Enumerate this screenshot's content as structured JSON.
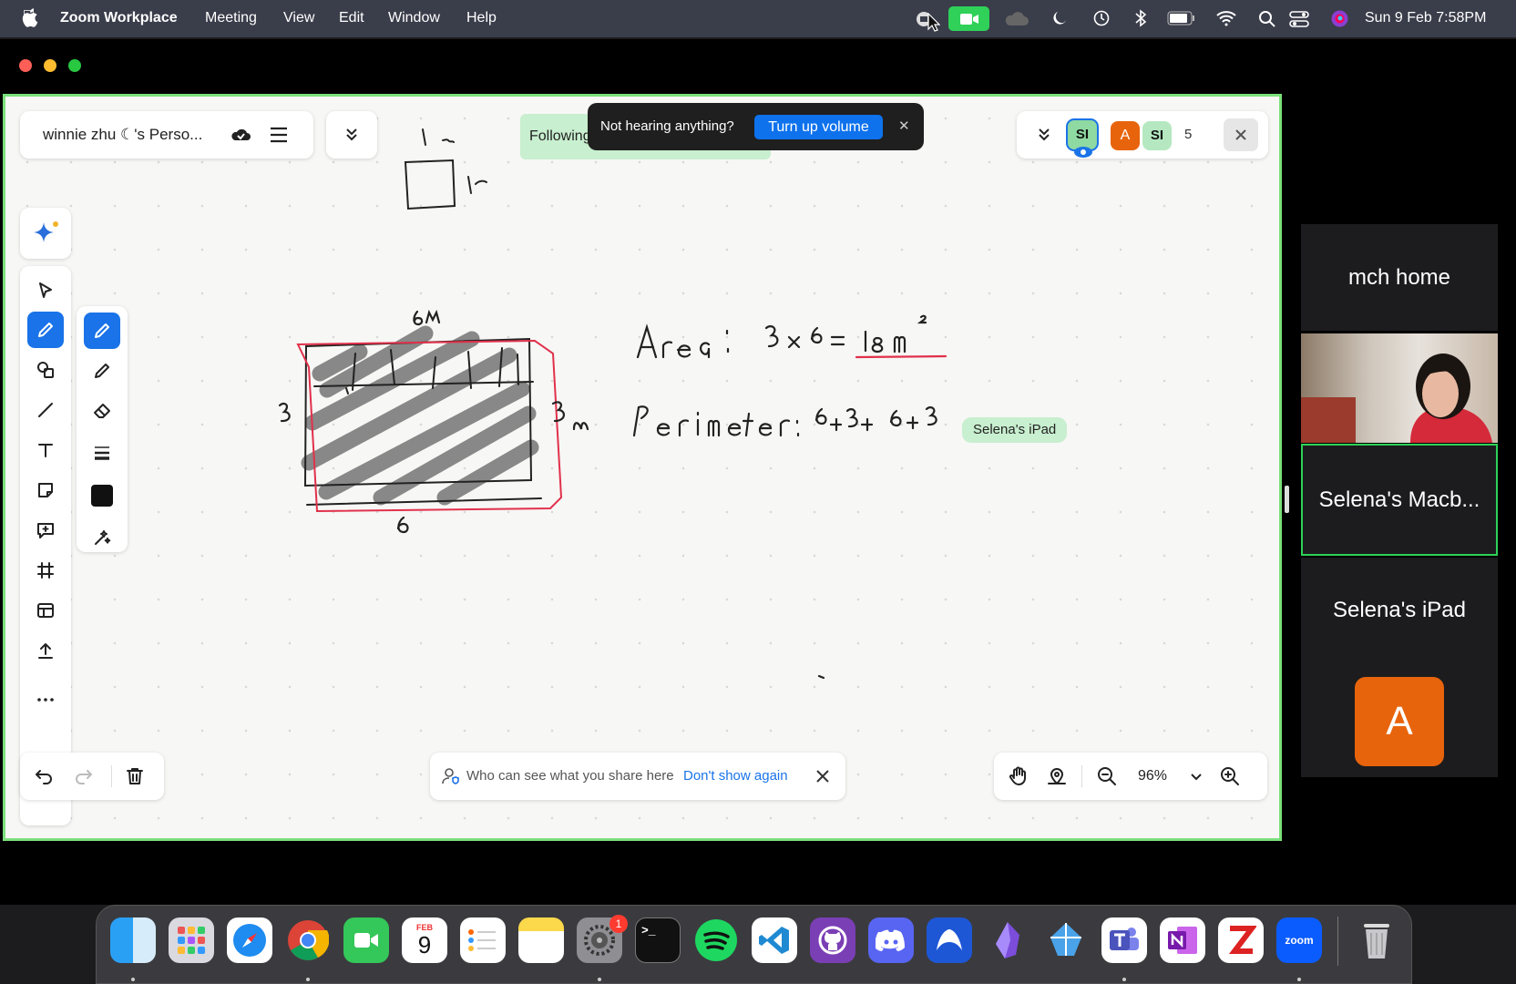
{
  "menubar": {
    "app": "Zoom Workplace",
    "items": [
      "Meeting",
      "View",
      "Edit",
      "Window",
      "Help"
    ],
    "clock": "Sun 9 Feb  7:58PM"
  },
  "board": {
    "title": "winnie zhu ☾'s Perso...",
    "following": "Following"
  },
  "toast": {
    "message": "Not hearing anything?",
    "button": "Turn up volume"
  },
  "participants": {
    "count": "5",
    "badges": [
      {
        "label": "SI",
        "color": "#8fd9a2"
      },
      {
        "label": "A",
        "color": "#e8640c"
      },
      {
        "label": "SI",
        "color": "#b5e8c0"
      }
    ]
  },
  "cursor_label": "Selena's iPad",
  "share_notice": {
    "text": "Who can see what you share here",
    "link": "Don't show again"
  },
  "zoom": {
    "level": "96%"
  },
  "tiles": [
    {
      "name": "mch home"
    },
    {
      "name": "Selena's Macb..."
    },
    {
      "name": "Selena's iPad"
    },
    {
      "initial": "A"
    }
  ],
  "dock": {
    "calendar_month": "FEB",
    "calendar_day": "9",
    "settings_badge": "1",
    "zoom_label": "zoom",
    "apps": [
      "Finder",
      "Launchpad",
      "Safari",
      "Chrome",
      "FaceTime",
      "Calendar",
      "Reminders",
      "Notes",
      "System Settings",
      "Terminal",
      "Spotify",
      "VS Code",
      "GitHub Desktop",
      "Discord",
      "Mountain Duck",
      "Obsidian",
      "Perplexity",
      "Teams",
      "OneNote",
      "Zotero",
      "Zoom",
      "Trash"
    ]
  },
  "colors": {
    "accent_green": "#7be07c",
    "active_tool": "#1a73e8",
    "avatar_orange": "#e8640c",
    "ink_red": "#d63a4a"
  }
}
